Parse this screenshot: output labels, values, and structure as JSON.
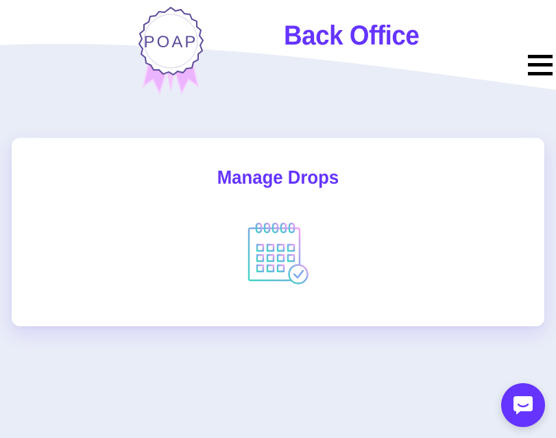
{
  "header": {
    "title": "Back Office",
    "logo_text": "POAP",
    "menu_icon": "hamburger-menu-icon"
  },
  "main": {
    "card": {
      "title": "Manage Drops",
      "icon": "calendar-check-icon"
    }
  },
  "support": {
    "icon": "chat-bubble-icon"
  },
  "colors": {
    "accent": "#6534ff",
    "background": "#e9edf7",
    "card": "#ffffff",
    "logo_stroke": "#5d4a9c",
    "ribbon": "#e8a6ff"
  }
}
